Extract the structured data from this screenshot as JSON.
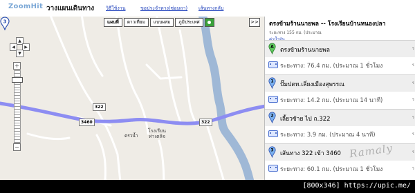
{
  "header": {
    "logo": "ZoomHit",
    "app_name": "วางแผนเดินทาง",
    "links": [
      {
        "label": "วิธีใช้งาน"
      },
      {
        "label": "ขอประจำทาง(ซ่อมถา)"
      },
      {
        "label": "เส้นทางกลับ"
      }
    ]
  },
  "map": {
    "map_types": [
      {
        "label": "แผนที่",
        "active": true
      },
      {
        "label": "ดาวเทียม",
        "active": false
      },
      {
        "label": "แบบผสม",
        "active": false
      },
      {
        "label": "ภูมิประเทศ",
        "active": false
      }
    ],
    "collapse_label": ">>",
    "zoom_in": "+",
    "zoom_out": "−",
    "pan_up": "▲",
    "pan_down": "▼",
    "pan_left": "◀",
    "pan_right": "▶",
    "route_color": "#7777ee",
    "river_color": "#9fb8d6",
    "shields": [
      "322",
      "3460",
      "322"
    ],
    "landmark_label": "โรงเรียน\nท่าเตลิจ",
    "marker_number": "3",
    "marker_label": "ตรวน้ำ"
  },
  "panel": {
    "title": "ตรงข้ามร้านนายพล -- โรงเรียนบ้านหนองปลา",
    "subtitle": "ระยะทาง 155 กม. (ประมาณ",
    "help_link": "ค่าน้ำมัน",
    "steps": [
      {
        "pin": "A",
        "pin_color": "#5ec85e",
        "text": "ตรงข้ามร้านนายพล",
        "distance": "ระยะทาง: 76.4 กม. (ประมาณ 1 ชั่วโมง"
      },
      {
        "pin": "1",
        "pin_color": "#7ab0ee",
        "text": "ปั๊มปตท.เลี่ยงเมืองสุพรรณ",
        "distance": "ระยะทาง: 14.2 กม. (ประมาณ 14 นาที)"
      },
      {
        "pin": "2",
        "pin_color": "#7ab0ee",
        "text": "เลี้ยวซ้าย ไป ถ.322",
        "distance": "ระยะทาง: 3.9 กม. (ประมาณ 4 นาที)"
      },
      {
        "pin": "3",
        "pin_color": "#7ab0ee",
        "text": "เส้นทาง 322 เข้า 3460",
        "distance": "ระยะทาง: 60.1 กม. (ประมาณ 1 ชั่วโมง"
      }
    ],
    "more_symbol": "ร"
  },
  "watermark": "Ramaly",
  "footer": "[800x346] https://upic.me/"
}
